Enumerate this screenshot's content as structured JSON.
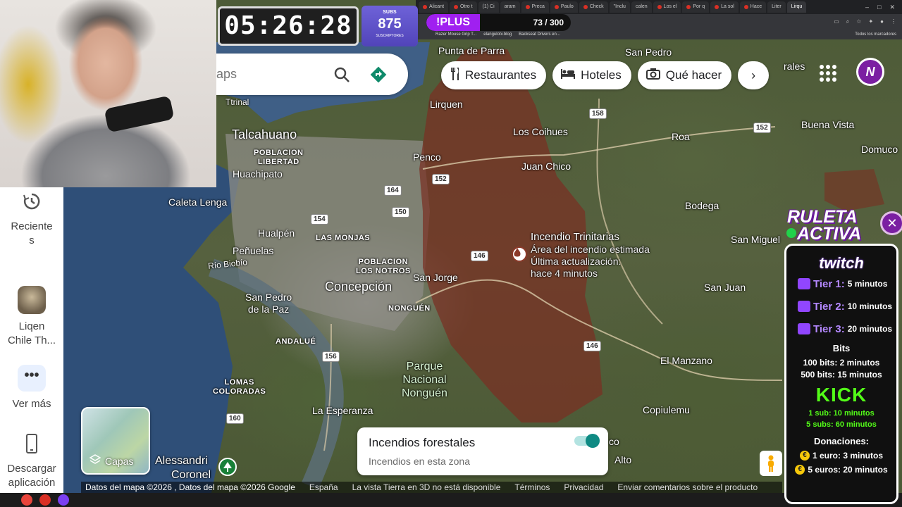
{
  "timer": {
    "value": "05:26:28"
  },
  "subs": {
    "label": "SUBS",
    "count": "875",
    "sublabel": "SUSCRIPTORES"
  },
  "goal": {
    "label": "!PLUS",
    "progress": "73 / 300",
    "progress_fraction": 0.243
  },
  "browser": {
    "tabs": [
      "Alicant",
      "Otro t",
      "(1) Ci",
      "aram",
      "Preca",
      "Paulo",
      "Check",
      "\"Inclu",
      "calen",
      "Los el",
      "Por q",
      "La sol",
      "Hace",
      "Liter",
      "Lirqu"
    ],
    "bookmarks": [
      "Razer Mouse Grip T...",
      "elangulotv.blog",
      "Backseat Drivers en..."
    ],
    "bookmarks_right": "Todos los marcadores"
  },
  "search": {
    "placeholder": "aps"
  },
  "chips": {
    "restaurants": "Restaurantes",
    "hotels": "Hoteles",
    "things_to_do": "Qué hacer",
    "more_arrow": "›"
  },
  "avatar": {
    "letter": "N"
  },
  "sidebar": {
    "recents": "Reciente\ns",
    "saved_place": "Liqen\nChile Th...",
    "more": "Ver más",
    "more_dots": "•••",
    "download_app": "Descargar\naplicación"
  },
  "layers": {
    "label": "Capas"
  },
  "fire_card": {
    "title": "Incendios forestales",
    "subtitle": "Incendios en esta zona",
    "toggle_on": true
  },
  "fire_marker": {
    "name": "Incendio Trinitarias",
    "line1": "Área del incendio estimada",
    "line2": "Última actualización:",
    "line3": "hace 4 minutos"
  },
  "map_labels": {
    "punta_de_parra": "Punta de Parra",
    "san_pedro": "San Pedro",
    "rales": "rales",
    "lirquen": "Lirquen",
    "los_coihues": "Los Coihues",
    "roa": "Roa",
    "buena_vista": "Buena Vista",
    "domuco": "Domuco",
    "talcahuano": "Talcahuano",
    "poblacion_libertad": "POBLACION\nLIBERTAD",
    "huachipato": "Huachipato",
    "tirtrinal": "Ttrinal",
    "penco": "Penco",
    "juan_chico": "Juan Chico",
    "bodega": "Bodega",
    "caleta_lenga": "Caleta Lenga",
    "hualpen": "Hualpén",
    "las_monjas": "LAS MONJAS",
    "penuelas": "Peñuelas",
    "rio_biobio": "Río Biobío",
    "poblacion_los_notros": "POBLACION\nLOS NOTROS",
    "san_jorge": "San Jorge",
    "concepcion": "Concepción",
    "san_miguel": "San Miguel",
    "san_juan": "San Juan",
    "san_pedro_de_la_paz": "San Pedro\nde la Paz",
    "nonguen": "NONGUÉN",
    "andalue": "ANDALUÉ",
    "parque_nacional_nonguen": "Parque\nNacional\nNonguén",
    "el_manzano": "El Manzano",
    "lomas_coloradas": "LOMAS\nCOLORADAS",
    "la_esperanza": "La Esperanza",
    "copiulemu": "Copiulemu",
    "co": "co",
    "alto": "Alto",
    "alessandri": "Alessandri",
    "coronel": "Coronel"
  },
  "route_shields": [
    "158",
    "152",
    "152",
    "164",
    "150",
    "154",
    "146",
    "146",
    "156",
    "160"
  ],
  "footer": {
    "map_data": "Datos del mapa ©2026 , Datos del mapa ©2026 Google",
    "country": "España",
    "tierra_3d": "La vista Tierra en 3D no está disponible",
    "terms": "Términos",
    "privacy": "Privacidad",
    "feedback": "Enviar comentarios sobre el producto"
  },
  "ruleta": {
    "line1": "RULETA",
    "line2": "ACTIVA"
  },
  "donations_panel": {
    "twitch_label": "twitch",
    "tiers": [
      {
        "name": "Tier 1:",
        "value": "5 minutos"
      },
      {
        "name": "Tier 2:",
        "value": "10 minutos"
      },
      {
        "name": "Tier 3:",
        "value": "20 minutos"
      }
    ],
    "bits_title": "Bits",
    "bits_lines": [
      "100 bits: 2 minutos",
      "500 bits: 15 minutos"
    ],
    "kick_label": "KICK",
    "kick_lines": [
      "1 sub: 10 minutos",
      "5 subs: 60 minutos"
    ],
    "donations_title": "Donaciones:",
    "donation_lines": [
      "1 euro: 3 minutos",
      "5 euros: 20 minutos"
    ],
    "coin_symbol": "€"
  },
  "colors": {
    "fire_area": "#7a2f22",
    "twitch_purple": "#9146ff",
    "kick_green": "#53fc18",
    "toggle_teal": "#0f8a83"
  }
}
